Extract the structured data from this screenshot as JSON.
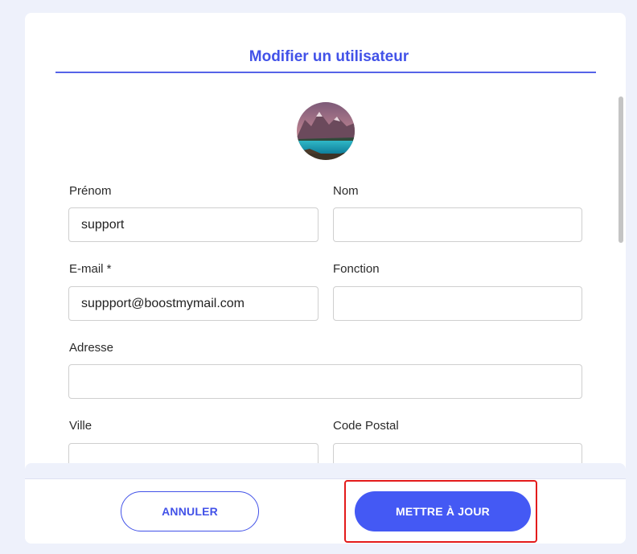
{
  "modal": {
    "title": "Modifier un utilisateur"
  },
  "form": {
    "first_name": {
      "label": "Prénom",
      "value": "support"
    },
    "last_name": {
      "label": "Nom",
      "value": ""
    },
    "email": {
      "label": "E-mail *",
      "value": "suppport@boostmymail.com"
    },
    "function": {
      "label": "Fonction",
      "value": ""
    },
    "address": {
      "label": "Adresse",
      "value": ""
    },
    "city": {
      "label": "Ville",
      "value": ""
    },
    "postal_code": {
      "label": "Code Postal",
      "value": ""
    }
  },
  "footer": {
    "cancel_label": "ANNULER",
    "update_label": "METTRE À JOUR"
  },
  "colors": {
    "accent": "#4252e8",
    "highlight": "#e31b1b"
  }
}
